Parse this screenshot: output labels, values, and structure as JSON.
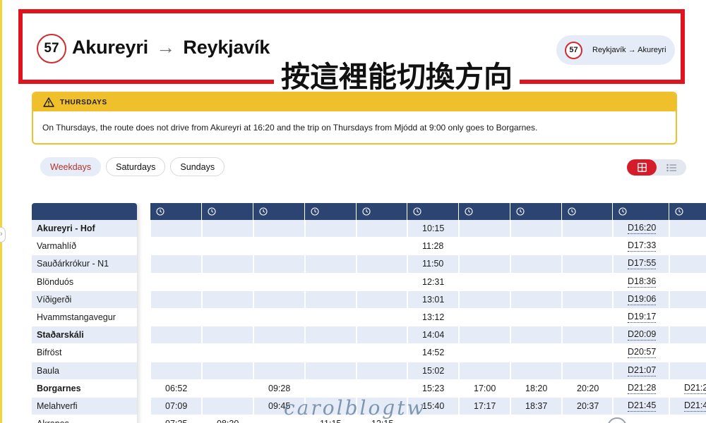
{
  "header": {
    "route_number": "57",
    "origin": "Akureyri",
    "arrow": "→",
    "destination": "Reykjavík",
    "switch_route_number": "57",
    "switch_label": "Reykjavík → Akureyri",
    "annotation_zh": "按這裡能切換方向"
  },
  "notice": {
    "title": "THURSDAYS",
    "text": "On Thursdays, the route does not drive from Akureyri at 16:20 and the trip on Thursdays from Mjódd at 9:00 only goes to Borgarnes."
  },
  "day_tabs": [
    {
      "label": "Weekdays",
      "active": true
    },
    {
      "label": "Saturdays",
      "active": false
    },
    {
      "label": "Sundays",
      "active": false
    }
  ],
  "view_toggle": {
    "selected": "grid"
  },
  "stops": [
    {
      "name": "Akureyri - Hof",
      "bold": true
    },
    {
      "name": "Varmahlíð",
      "bold": false
    },
    {
      "name": "Sauðárkrókur - N1",
      "bold": false
    },
    {
      "name": "Blönduós",
      "bold": false
    },
    {
      "name": "Víðigerði",
      "bold": false
    },
    {
      "name": "Hvammstangavegur",
      "bold": false
    },
    {
      "name": "Staðarskáli",
      "bold": true
    },
    {
      "name": "Bifröst",
      "bold": false
    },
    {
      "name": "Baula",
      "bold": false
    },
    {
      "name": "Borgarnes",
      "bold": true
    },
    {
      "name": "Melahverfi",
      "bold": false
    },
    {
      "name": "Akranes",
      "bold": false
    }
  ],
  "trips": [
    {
      "times": [
        "",
        "",
        "",
        "",
        "",
        "",
        "",
        "",
        "",
        "06:52",
        "07:09",
        "07:25"
      ]
    },
    {
      "times": [
        "",
        "",
        "",
        "",
        "",
        "",
        "",
        "",
        "",
        "",
        "",
        "08:30"
      ]
    },
    {
      "times": [
        "",
        "",
        "",
        "",
        "",
        "",
        "",
        "",
        "",
        "09:28",
        "09:45",
        ""
      ]
    },
    {
      "times": [
        "",
        "",
        "",
        "",
        "",
        "",
        "",
        "",
        "",
        "",
        "",
        "11:15"
      ]
    },
    {
      "times": [
        "",
        "",
        "",
        "",
        "",
        "",
        "",
        "",
        "",
        "",
        "",
        "12:15"
      ]
    },
    {
      "times": [
        "10:15",
        "11:28",
        "11:50",
        "12:31",
        "13:01",
        "13:12",
        "14:04",
        "14:52",
        "15:02",
        "15:23",
        "15:40",
        ""
      ]
    },
    {
      "times": [
        "",
        "",
        "",
        "",
        "",
        "",
        "",
        "",
        "",
        "17:00",
        "17:17",
        ""
      ]
    },
    {
      "times": [
        "",
        "",
        "",
        "",
        "",
        "",
        "",
        "",
        "",
        "18:20",
        "18:37",
        ""
      ]
    },
    {
      "times": [
        "",
        "",
        "",
        "",
        "",
        "",
        "",
        "",
        "",
        "20:20",
        "20:37",
        ""
      ]
    },
    {
      "times": [
        "D16:20",
        "D17:33",
        "D17:55",
        "D18:36",
        "D19:06",
        "D19:17",
        "D20:09",
        "D20:57",
        "D21:07",
        "D21:28",
        "D21:45",
        ""
      ]
    },
    {
      "times": [
        "",
        "",
        "",
        "",
        "",
        "",
        "",
        "",
        "",
        "D21:2",
        "D21:4",
        ""
      ]
    }
  ],
  "watermark": "carolblogtw"
}
